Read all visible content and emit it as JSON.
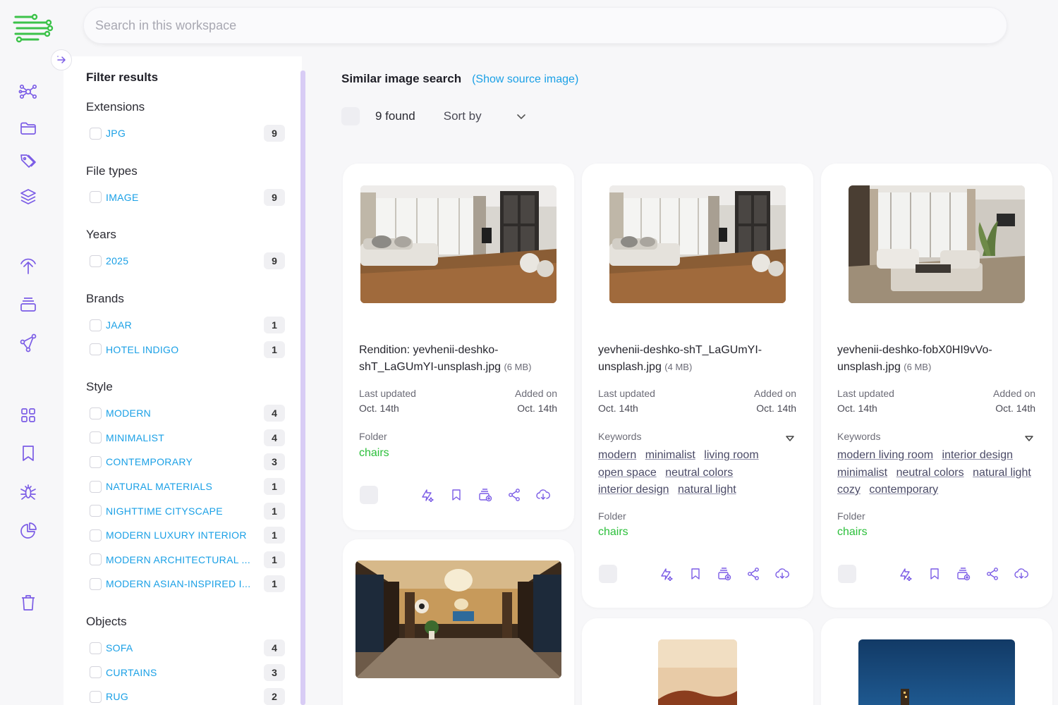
{
  "search": {
    "placeholder": "Search in this workspace"
  },
  "rail": {
    "icons": [
      "network-icon",
      "folder-icon",
      "tags-icon",
      "layers-icon",
      "upload-icon",
      "stack-icon",
      "share-graph-icon",
      "grid-icon",
      "bookmark-icon",
      "bug-icon",
      "pie-chart-icon",
      "trash-icon"
    ]
  },
  "filters": {
    "title": "Filter results",
    "groups": [
      {
        "name": "Extensions",
        "items": [
          {
            "label": "JPG",
            "count": "9"
          }
        ]
      },
      {
        "name": "File types",
        "items": [
          {
            "label": "IMAGE",
            "count": "9"
          }
        ]
      },
      {
        "name": "Years",
        "items": [
          {
            "label": "2025",
            "count": "9"
          }
        ]
      },
      {
        "name": "Brands",
        "items": [
          {
            "label": "JAAR",
            "count": "1"
          },
          {
            "label": "HOTEL INDIGO",
            "count": "1"
          }
        ]
      },
      {
        "name": "Style",
        "items": [
          {
            "label": "MODERN",
            "count": "4"
          },
          {
            "label": "MINIMALIST",
            "count": "4"
          },
          {
            "label": "CONTEMPORARY",
            "count": "3"
          },
          {
            "label": "NATURAL MATERIALS",
            "count": "1"
          },
          {
            "label": "NIGHTTIME CITYSCAPE",
            "count": "1"
          },
          {
            "label": "MODERN LUXURY INTERIOR",
            "count": "1"
          },
          {
            "label": "MODERN ARCHITECTURAL ...",
            "count": "1"
          },
          {
            "label": "MODERN ASIAN-INSPIRED I...",
            "count": "1"
          }
        ]
      },
      {
        "name": "Objects",
        "items": [
          {
            "label": "SOFA",
            "count": "4"
          },
          {
            "label": "CURTAINS",
            "count": "3"
          },
          {
            "label": "RUG",
            "count": "2"
          }
        ]
      }
    ]
  },
  "main": {
    "title": "Similar image search",
    "source_link": "(Show source image)",
    "found": "9 found",
    "sort_label": "Sort by"
  },
  "cards": [
    {
      "name": "Rendition: yevhenii-deshko-shT_LaGUmYI-unsplash.jpg",
      "size": "(6 MB)",
      "last_updated_label": "Last updated",
      "last_updated": "Oct. 14th",
      "added_label": "Added on",
      "added": "Oct. 14th",
      "keywords_label": "",
      "keywords": [],
      "folder_label": "Folder",
      "folder": "chairs"
    },
    {
      "name": "yevhenii-deshko-shT_LaGUmYI-unsplash.jpg",
      "size": "(4 MB)",
      "last_updated_label": "Last updated",
      "last_updated": "Oct. 14th",
      "added_label": "Added on",
      "added": "Oct. 14th",
      "keywords_label": "Keywords",
      "keywords": [
        "modern",
        "minimalist",
        "living room",
        "open space",
        "neutral colors",
        "interior design",
        "natural light"
      ],
      "folder_label": "Folder",
      "folder": "chairs"
    },
    {
      "name": "yevhenii-deshko-fobX0HI9vVo-unsplash.jpg",
      "size": "(6 MB)",
      "last_updated_label": "Last updated",
      "last_updated": "Oct. 14th",
      "added_label": "Added on",
      "added": "Oct. 14th",
      "keywords_label": "Keywords",
      "keywords": [
        "modern living room",
        "interior design",
        "minimalist",
        "neutral colors",
        "natural light",
        "cozy",
        "contemporary"
      ],
      "folder_label": "Folder",
      "folder": "chairs"
    }
  ],
  "card_actions": [
    "ai-edit-icon",
    "bookmark-icon",
    "add-to-collection-icon",
    "share-icon",
    "download-icon"
  ],
  "colors": {
    "accent": "#7b5ce6",
    "link": "#1aa0e6",
    "folder": "#2bbf3a",
    "logo": "#3cc24a"
  }
}
